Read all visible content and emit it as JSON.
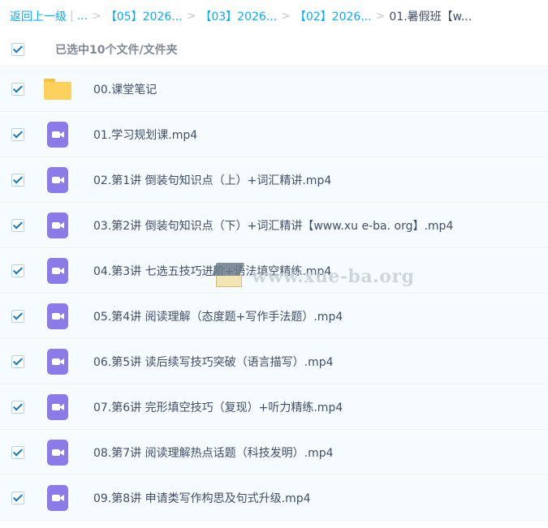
{
  "breadcrumb": {
    "back": "返回上一级",
    "ellipsis": "...",
    "sep": ">",
    "items": [
      "【05】2026...",
      "【03】2026...",
      "【02】2026..."
    ],
    "current": "01.暑假班【w..."
  },
  "header": {
    "selected_text": "已选中10个文件/文件夹"
  },
  "files": [
    {
      "name": "00.课堂笔记",
      "type": "folder"
    },
    {
      "name": "01.学习规划课.mp4",
      "type": "video"
    },
    {
      "name": "02.第1讲 倒装句知识点（上）+词汇精讲.mp4",
      "type": "video"
    },
    {
      "name": "03.第2讲 倒装句知识点（下）+词汇精讲【www.xu e-ba. org】.mp4",
      "type": "video"
    },
    {
      "name": "04.第3讲 七选五技巧进阶+语法填空精练.mp4",
      "type": "video"
    },
    {
      "name": "05.第4讲 阅读理解（态度题+写作手法题）.mp4",
      "type": "video"
    },
    {
      "name": "06.第5讲 读后续写技巧突破（语言描写）.mp4",
      "type": "video"
    },
    {
      "name": "07.第6讲 完形填空技巧（复现）+听力精练.mp4",
      "type": "video"
    },
    {
      "name": "08.第7讲 阅读理解热点话题（科技发明）.mp4",
      "type": "video"
    },
    {
      "name": "09.第8讲 申请类写作构思及句式升级.mp4",
      "type": "video"
    }
  ],
  "watermark": {
    "text": "www.xue-ba.org"
  },
  "colors": {
    "link": "#09aaff",
    "row_bg": "#f5fbff",
    "folder": "#fdd15c",
    "video": "#8a7be8",
    "check": "#0f76c6"
  }
}
